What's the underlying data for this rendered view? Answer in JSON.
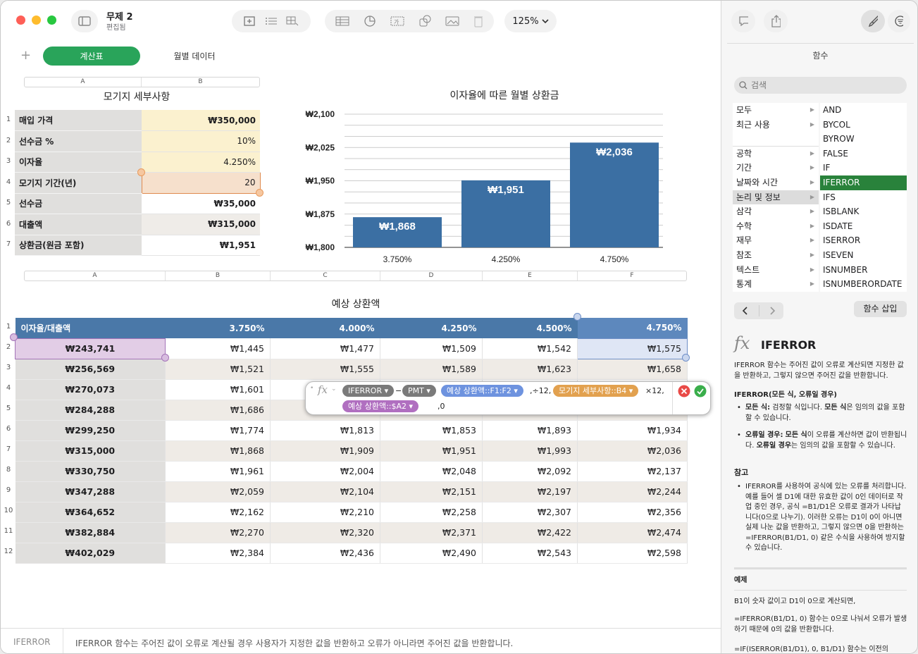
{
  "window": {
    "title": "무제 2",
    "subtitle": "편집됨",
    "zoom": "125%"
  },
  "sheets": {
    "active": "계산표",
    "other": "월별 데이터"
  },
  "table1": {
    "title": "모기지 세부사항",
    "col_headers": [
      "A",
      "B"
    ],
    "rows": [
      {
        "n": "1",
        "label": "매입 가격",
        "value": "₩350,000"
      },
      {
        "n": "2",
        "label": "선수금 %",
        "value": "10%"
      },
      {
        "n": "3",
        "label": "이자율",
        "value": "4.250%"
      },
      {
        "n": "4",
        "label": "모기지 기간(년)",
        "value": "20"
      },
      {
        "n": "5",
        "label": "선수금",
        "value": "₩35,000"
      },
      {
        "n": "6",
        "label": "대출액",
        "value": "₩315,000"
      },
      {
        "n": "7",
        "label": "상환금(원금 포함)",
        "value": "₩1,951"
      }
    ]
  },
  "chart_data": {
    "type": "bar",
    "title": "이자율에 따른 월별 상환금",
    "categories": [
      "3.750%",
      "4.250%",
      "4.750%"
    ],
    "values": [
      1868,
      1951,
      2036
    ],
    "data_labels": [
      "₩1,868",
      "₩1,951",
      "₩2,036"
    ],
    "ylim": [
      1800,
      2100
    ],
    "yticks": [
      "₩2,100",
      "₩2,025",
      "₩1,950",
      "₩1,875",
      "₩1,800"
    ],
    "grid": true,
    "bar_color": "#3b6fa3"
  },
  "table2": {
    "title": "예상 상환액",
    "col_headers": [
      "A",
      "B",
      "C",
      "D",
      "E",
      "F"
    ],
    "header": [
      "이자율/대출액",
      "3.750%",
      "4.000%",
      "4.250%",
      "4.500%",
      "4.750%"
    ],
    "rows": [
      [
        "₩243,741",
        "₩1,445",
        "₩1,477",
        "₩1,509",
        "₩1,542",
        "₩1,575"
      ],
      [
        "₩256,569",
        "₩1,521",
        "₩1,555",
        "₩1,589",
        "₩1,623",
        "₩1,658"
      ],
      [
        "₩270,073",
        "₩1,601",
        "",
        "",
        "",
        ""
      ],
      [
        "₩284,288",
        "₩1,686",
        "",
        "",
        "",
        ""
      ],
      [
        "₩299,250",
        "₩1,774",
        "₩1,813",
        "₩1,853",
        "₩1,893",
        "₩1,934"
      ],
      [
        "₩315,000",
        "₩1,868",
        "₩1,909",
        "₩1,951",
        "₩1,993",
        "₩2,036"
      ],
      [
        "₩330,750",
        "₩1,961",
        "₩2,004",
        "₩2,048",
        "₩2,092",
        "₩2,137"
      ],
      [
        "₩347,288",
        "₩2,059",
        "₩2,104",
        "₩2,151",
        "₩2,197",
        "₩2,244"
      ],
      [
        "₩364,652",
        "₩2,162",
        "₩2,210",
        "₩2,258",
        "₩2,307",
        "₩2,356"
      ],
      [
        "₩382,884",
        "₩2,270",
        "₩2,320",
        "₩2,371",
        "₩2,422",
        "₩2,474"
      ],
      [
        "₩402,029",
        "₩2,384",
        "₩2,436",
        "₩2,490",
        "₩2,543",
        "₩2,598"
      ]
    ]
  },
  "formula": {
    "fn1": "IFERROR",
    "minus": "−",
    "fn2": "PMT",
    "ref1": "예상 상환액::F1:F2",
    "sep1": ",÷12,",
    "ref2": "모기지 세부사항::B4",
    "sep2": "×12,",
    "ref3": "예상 상환액::$A2",
    "tail": ",0"
  },
  "sidebar": {
    "title": "함수",
    "search_placeholder": "검색",
    "categories": [
      "모두",
      "최근 사용",
      "",
      "공학",
      "기간",
      "날짜와 시간",
      "논리 및 정보",
      "삼각",
      "수학",
      "재무",
      "참조",
      "텍스트",
      "통계"
    ],
    "functions": [
      "AND",
      "BYCOL",
      "BYROW",
      "FALSE",
      "IF",
      "IFERROR",
      "IFS",
      "ISBLANK",
      "ISDATE",
      "ISERROR",
      "ISEVEN",
      "ISNUMBER",
      "ISNUMBERORDATE"
    ],
    "selected_function": "IFERROR",
    "insert_label": "함수 삽입",
    "fn_title": "IFERROR",
    "desc": "IFERROR 함수는 주어진 값이 오류로 계산되면 지정한 값을 반환하고, 그렇지 않으면 주어진 값을 반환합니다.",
    "syntax": "IFERROR(모든 식, 오류일 경우)",
    "arg1_name": "모든 식:",
    "arg1_desc": " 검정할 식입니다. ",
    "arg1_name2": "모든 식",
    "arg1_desc2": "은 임의의 값을 포함할 수 있습니다.",
    "arg2_name": "오류일 경우:",
    "arg2_name_b": "모든 식",
    "arg2_desc": "이 오류를 계산하면 값이 반환됩니다. ",
    "arg2_name2": "오류일 경우",
    "arg2_desc2": "는 임의의 값을 포함할 수 있습니다.",
    "notes_title": "참고",
    "notes": "IFERROR를 사용하여 공식에 있는 오류를 처리합니다. 예를 들어 셀 D1에 대한 유효한 값이 0인 데이터로 작업 중인 경우, 공식 =B1/D1은 오류로 결과가 나타납니다(0으로 나누기). 이러한 오류는 D1이 0이 아니면 실제 나눈 값을 반환하고, 그렇지 않으면 0을 반환하는 =IFERROR(B1/D1, 0) 같은 수식을 사용하여 방지할 수 있습니다.",
    "example_title": "예제",
    "ex1": "B1이 숫자 값이고 D1이 0으로 계산되면,",
    "ex2": "=IFERROR(B1/D1, 0) 함수는 0으로 나눠서 오류가 발생하기 때문에 0의 값을 반환합니다.",
    "ex3": "=IF(ISERROR(B1/D1), 0, B1/D1) 함수는 이전의"
  },
  "status": {
    "fn": "IFERROR",
    "text": "IFERROR 함수는 주어진 값이 오류로 계산될 경우 사용자가 지정한 값을 반환하고 오류가 아니라면 주어진 값을 반환합니다."
  }
}
